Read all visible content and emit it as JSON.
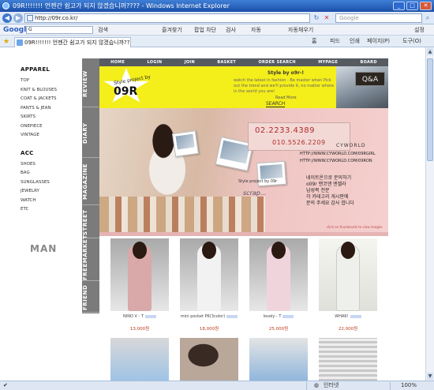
{
  "window": {
    "title": "09R!!!!!!! 언젠간 쉼고가 되지 않겠습니까???? - Windows Internet Explorer",
    "controls": [
      "minimize",
      "maximize",
      "close"
    ]
  },
  "address": {
    "url": "http://09r.co.kr/",
    "search_placeholder": "Google"
  },
  "googlebar": {
    "logo": "Google",
    "search_value": "G",
    "go_label": "검색",
    "bookmarks_label": "즐겨찾기",
    "popups_label": "팝업 차단",
    "check_label": "검사",
    "autolink_label": "자동",
    "autofill_label": "자동채우기",
    "options_label": "설정"
  },
  "tab": {
    "label": "09R!!!!!!! 언젠간 쉼고가 되지 않겠습니까???"
  },
  "commandbar": {
    "home": "홈",
    "feeds": "피드",
    "print": "인쇄",
    "page": "페이지(P)",
    "tools": "도구(O)"
  },
  "site": {
    "categories_apparel": {
      "heading": "APPAREL",
      "items": [
        "TOP",
        "KNIT & BLOUSES",
        "COAT & JACKETS",
        "PANTS & JEAN",
        "SKIRTS",
        "ONEPIECE",
        "VINTAGE"
      ]
    },
    "categories_acc": {
      "heading": "ACC",
      "items": [
        "SHOES",
        "BAG",
        "SUNGLASSES",
        "JEWELRY",
        "WATCH",
        "ETC"
      ]
    },
    "man_label": "MAN",
    "side_tabs": [
      "REVIEW",
      "DIARY",
      "MAGAZINE",
      "STREET",
      "FREEMARKET",
      "FRIEND"
    ],
    "top_nav": [
      "HOME",
      "LOGIN",
      "JOIN",
      "BASKET",
      "ORDER SEARCH",
      "MYPAGE",
      "BOARD"
    ],
    "banner": {
      "logo_top": "Style project by",
      "logo_main": "09R",
      "tagline": "Style by o9r-!",
      "text": "watch the latest in fashion - Be master when Pick out the trend and we'll provide it, no matter where in the world you are!",
      "read_more": "Read More",
      "search_label": "SEARCH",
      "sign": "Q&A"
    },
    "hero": {
      "phone1": "02.2233.4389",
      "phone2": "010.5526.2209",
      "cyworld": "CYWORLD",
      "cy_url1": "HTTP://WWW.CYWORLD.COM/09RGIRL",
      "cy_url2": "HTTP://WWW.CYWORLD.COM/09RON",
      "note_lines": [
        "네이트온으로 문의하기",
        "o09r 맨코앤 엔젤라",
        "남성복 전문",
        "각 카테고리 게시판에",
        "문의 주세요 감사 합니다"
      ],
      "mini_caption": "Style project by 09r",
      "scrap": "scrap...",
      "thumb_note": "click on thumbnails to view images"
    },
    "products": [
      {
        "name": "NINO V - T",
        "price": "13,000원",
        "color": "#d9a8a8"
      },
      {
        "name": "mini pocket PK(3color)",
        "price": "18,000원",
        "color": "#f2f2f2"
      },
      {
        "name": "lovely - T",
        "price": "25,000원",
        "color": "#f0d4dc"
      },
      {
        "name": "WHAK!",
        "price": "22,000원",
        "color": "#eef0ec"
      }
    ],
    "products_row2_colors": [
      "#9ec3e6",
      "#3a2a24",
      "#8fb6dc",
      "#c9c9c9"
    ]
  },
  "status": {
    "zone": "인터넷",
    "zoom": "100%"
  }
}
